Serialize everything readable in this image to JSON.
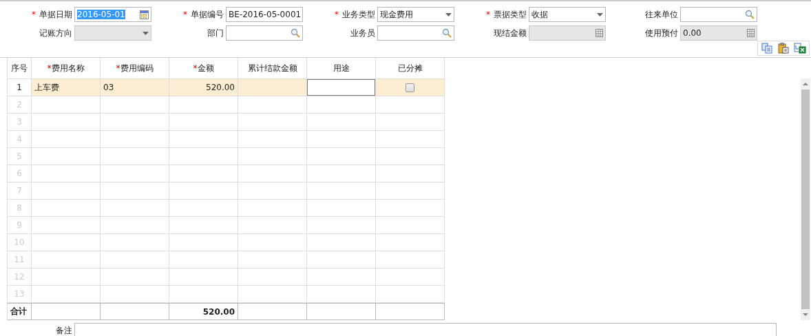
{
  "form": {
    "rows": [
      [
        {
          "label": "单据日期",
          "required_mark": "*",
          "kind": "date",
          "value": "2016-05-01",
          "highlighted": true,
          "disabled": false
        },
        {
          "label": "单据编号",
          "required_mark": "*",
          "kind": "text",
          "value": "BE-2016-05-0001",
          "disabled": false
        },
        {
          "label": "业务类型",
          "required_mark": "*",
          "kind": "select",
          "value": "现金费用",
          "disabled": false
        },
        {
          "label": "票据类型",
          "required_mark": "*",
          "kind": "select",
          "value": "收据",
          "disabled": false
        },
        {
          "label": "往来单位",
          "kind": "lookup",
          "disabled": false
        }
      ],
      [
        {
          "label": "记账方向",
          "kind": "select",
          "disabled": true
        },
        {
          "label": "部门",
          "kind": "lookup",
          "disabled": false
        },
        {
          "label": "业务员",
          "kind": "lookup",
          "disabled": false
        },
        {
          "label": "现结金额",
          "kind": "number",
          "disabled": true
        },
        {
          "label": "使用预付",
          "kind": "number",
          "value": "0.00",
          "disabled": true
        }
      ]
    ]
  },
  "table": {
    "columns": [
      {
        "label": "序号"
      },
      {
        "label": "费用名称",
        "required_mark": "*"
      },
      {
        "label": "费用编码",
        "required_mark": "*"
      },
      {
        "label": "金额",
        "required_mark": "*"
      },
      {
        "label": "累计结款金额"
      },
      {
        "label": "用途"
      },
      {
        "label": "已分摊"
      }
    ],
    "rows": [
      {
        "no": "1",
        "selected": true,
        "name": "上车费",
        "code": "03",
        "amount": "520.00",
        "editing_purpose": true,
        "allocated": {
          "checked": false
        }
      },
      {
        "no": "2",
        "selected": false
      },
      {
        "no": "3",
        "selected": false
      },
      {
        "no": "4",
        "selected": false
      },
      {
        "no": "5",
        "selected": false
      },
      {
        "no": "6",
        "selected": false
      },
      {
        "no": "7",
        "selected": false
      },
      {
        "no": "8",
        "selected": false
      },
      {
        "no": "9",
        "selected": false
      },
      {
        "no": "10",
        "selected": false
      },
      {
        "no": "11",
        "selected": false
      },
      {
        "no": "12",
        "selected": false
      },
      {
        "no": "13",
        "selected": false
      }
    ],
    "totals": {
      "label": "合计",
      "amount": "520.00"
    }
  },
  "remark": {
    "label": "备注"
  }
}
